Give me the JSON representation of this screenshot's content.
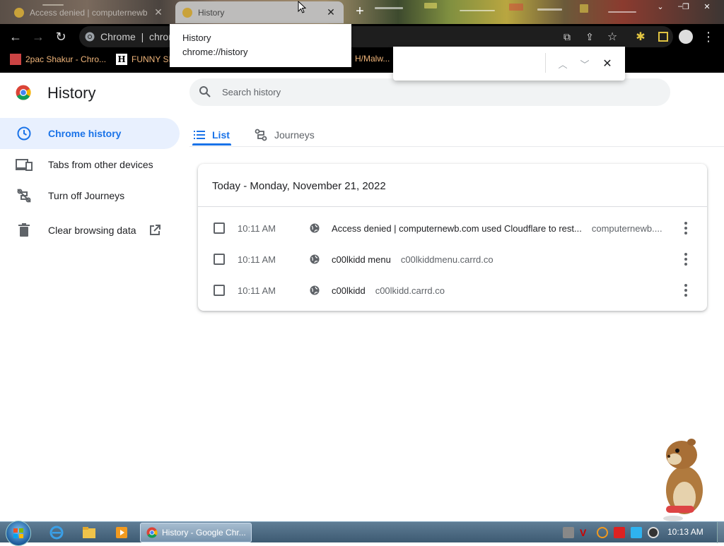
{
  "browser": {
    "tabs": [
      {
        "title": "Access denied | computernewb...",
        "active": false
      },
      {
        "title": "History",
        "active": true
      }
    ],
    "omnibox": {
      "text": "Chrome  |  chrom"
    },
    "bookmarks": [
      {
        "label": "2pac Shakur - Chro..."
      },
      {
        "label": "FUNNY SI"
      },
      {
        "label": "H/Malw..."
      }
    ],
    "tab_popup": {
      "title": "History",
      "url": "chrome://history"
    }
  },
  "app": {
    "title": "History",
    "search_placeholder": "Search history",
    "sidebar": [
      {
        "label": "Chrome history",
        "icon": "clock-icon",
        "active": true
      },
      {
        "label": "Tabs from other devices",
        "icon": "devices-icon",
        "active": false
      },
      {
        "label": "Turn off Journeys",
        "icon": "journeys-off-icon",
        "active": false
      },
      {
        "label": "Clear browsing data",
        "icon": "trash-icon",
        "active": false
      }
    ],
    "view_tabs": [
      {
        "label": "List",
        "active": true
      },
      {
        "label": "Journeys",
        "active": false
      }
    ],
    "day_header": "Today - Monday, November 21, 2022",
    "entries": [
      {
        "time": "10:11 AM",
        "title": "Access denied | computernewb.com used Cloudflare to rest...",
        "domain": "computernewb...."
      },
      {
        "time": "10:11 AM",
        "title": "c00lkidd menu",
        "domain": "c00lkiddmenu.carrd.co"
      },
      {
        "time": "10:11 AM",
        "title": "c00lkidd",
        "domain": "c00lkidd.carrd.co"
      }
    ]
  },
  "taskbar": {
    "task_label": "History - Google Chr...",
    "clock": "10:13 AM"
  },
  "colors": {
    "accent": "#1a73e8",
    "active_nav_bg": "#e8f0fe"
  }
}
